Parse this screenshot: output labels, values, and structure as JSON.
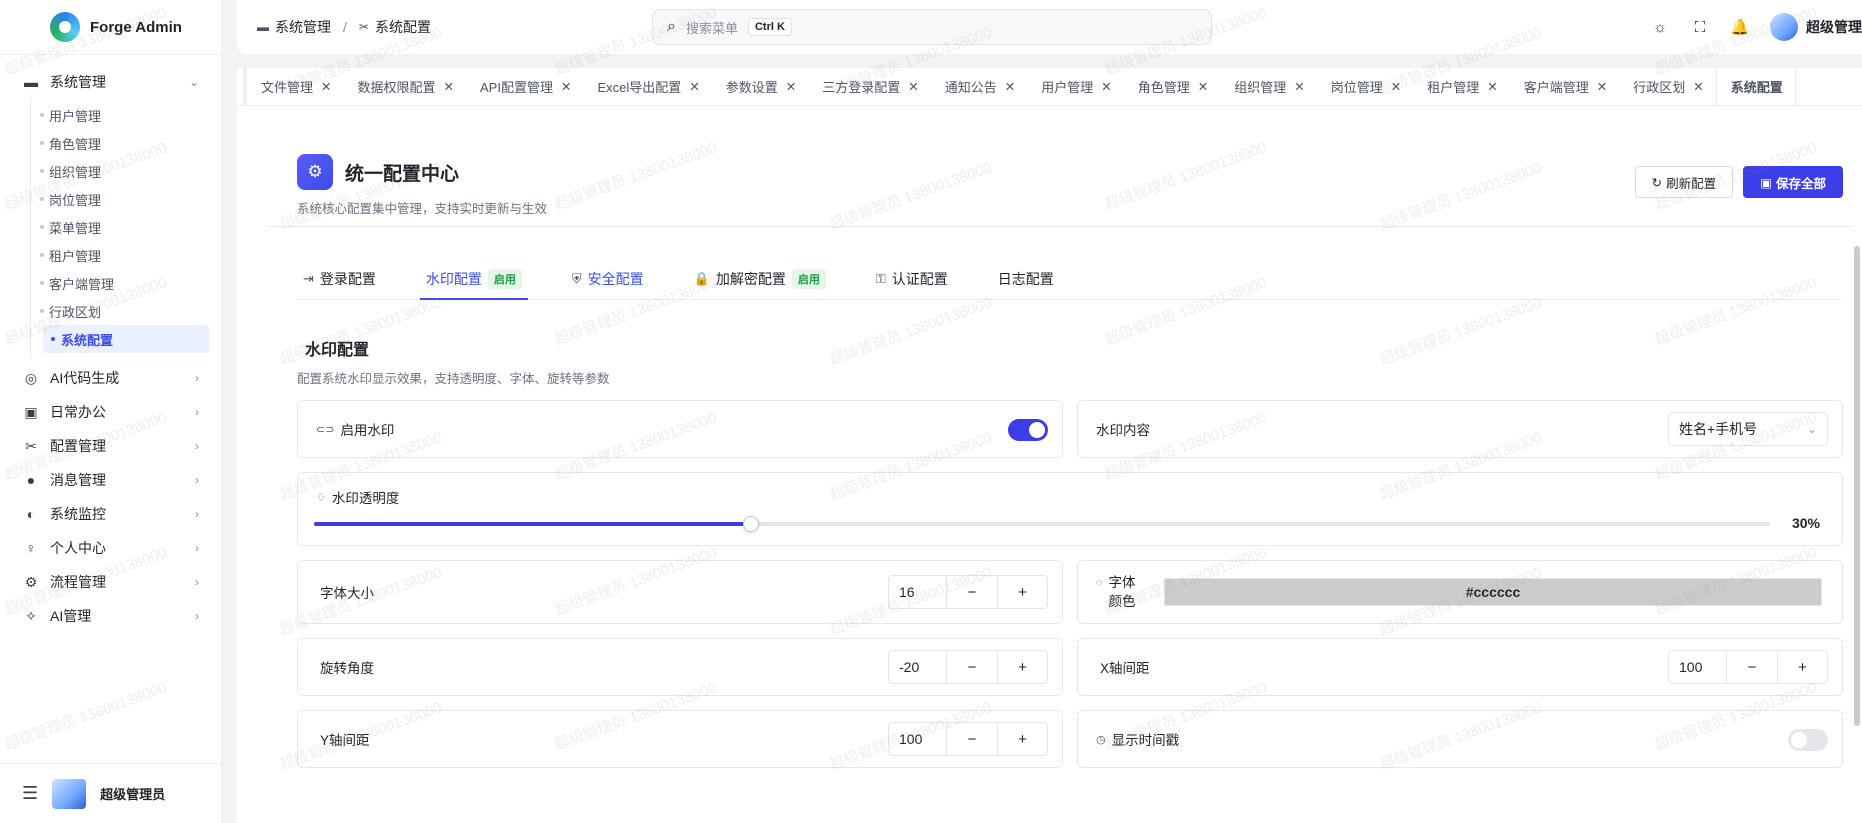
{
  "brand": {
    "name": "Forge Admin"
  },
  "sidebar": {
    "groups": [
      {
        "label": "系统管理",
        "icon": "folder-icon",
        "expanded": true
      },
      {
        "label": "AI代码生成",
        "icon": "ai-code-icon"
      },
      {
        "label": "日常办公",
        "icon": "briefcase-icon"
      },
      {
        "label": "配置管理",
        "icon": "tools-icon"
      },
      {
        "label": "消息管理",
        "icon": "message-icon"
      },
      {
        "label": "系统监控",
        "icon": "monitor-icon"
      },
      {
        "label": "个人中心",
        "icon": "person-icon"
      },
      {
        "label": "流程管理",
        "icon": "gear-icon"
      },
      {
        "label": "AI管理",
        "icon": "magic-wand-icon"
      }
    ],
    "subitems": [
      {
        "label": "用户管理"
      },
      {
        "label": "角色管理"
      },
      {
        "label": "组织管理"
      },
      {
        "label": "岗位管理"
      },
      {
        "label": "菜单管理"
      },
      {
        "label": "租户管理"
      },
      {
        "label": "客户端管理"
      },
      {
        "label": "行政区划"
      },
      {
        "label": "系统配置",
        "active": true
      }
    ],
    "user": "超级管理员"
  },
  "header": {
    "breadcrumb": [
      "系统管理",
      "系统配置"
    ],
    "breadcrumb_sep": "/",
    "search_placeholder": "搜索菜单",
    "shortcut": "Ctrl K",
    "user": "超级管理"
  },
  "tabs": [
    "文件管理",
    "数据权限配置",
    "API配置管理",
    "Excel导出配置",
    "参数设置",
    "三方登录配置",
    "通知公告",
    "用户管理",
    "角色管理",
    "组织管理",
    "岗位管理",
    "租户管理",
    "客户端管理",
    "行政区划",
    "系统配置"
  ],
  "page": {
    "title": "统一配置中心",
    "desc": "系统核心配置集中管理，支持实时更新与生效",
    "refresh_label": "刷新配置",
    "save_label": "保存全部"
  },
  "config_tabs": [
    {
      "label": "登录配置"
    },
    {
      "label": "水印配置",
      "badge": "启用",
      "active": true
    },
    {
      "label": "安全配置"
    },
    {
      "label": "加解密配置",
      "badge": "启用"
    },
    {
      "label": "认证配置"
    },
    {
      "label": "日志配置"
    }
  ],
  "watermark": {
    "title": "水印配置",
    "desc": "配置系统水印显示效果，支持透明度、字体、旋转等参数",
    "enable_label": "启用水印",
    "enabled": true,
    "content_label": "水印内容",
    "content_value": "姓名+手机号",
    "opacity_label": "水印透明度",
    "opacity_value": "30%",
    "opacity": 30,
    "font_size_label": "字体大小",
    "font_size": "16",
    "font_color_label": "字体颜色",
    "font_color": "#cccccc",
    "rotate_label": "旋转角度",
    "rotate": "-20",
    "x_gap_label": "X轴间距",
    "x_gap": "100",
    "y_gap_label": "Y轴间距",
    "y_gap": "100",
    "timestamp_label": "显示时间戳",
    "timestamp": false
  },
  "watermark_text": "超级管理员 13800138000"
}
